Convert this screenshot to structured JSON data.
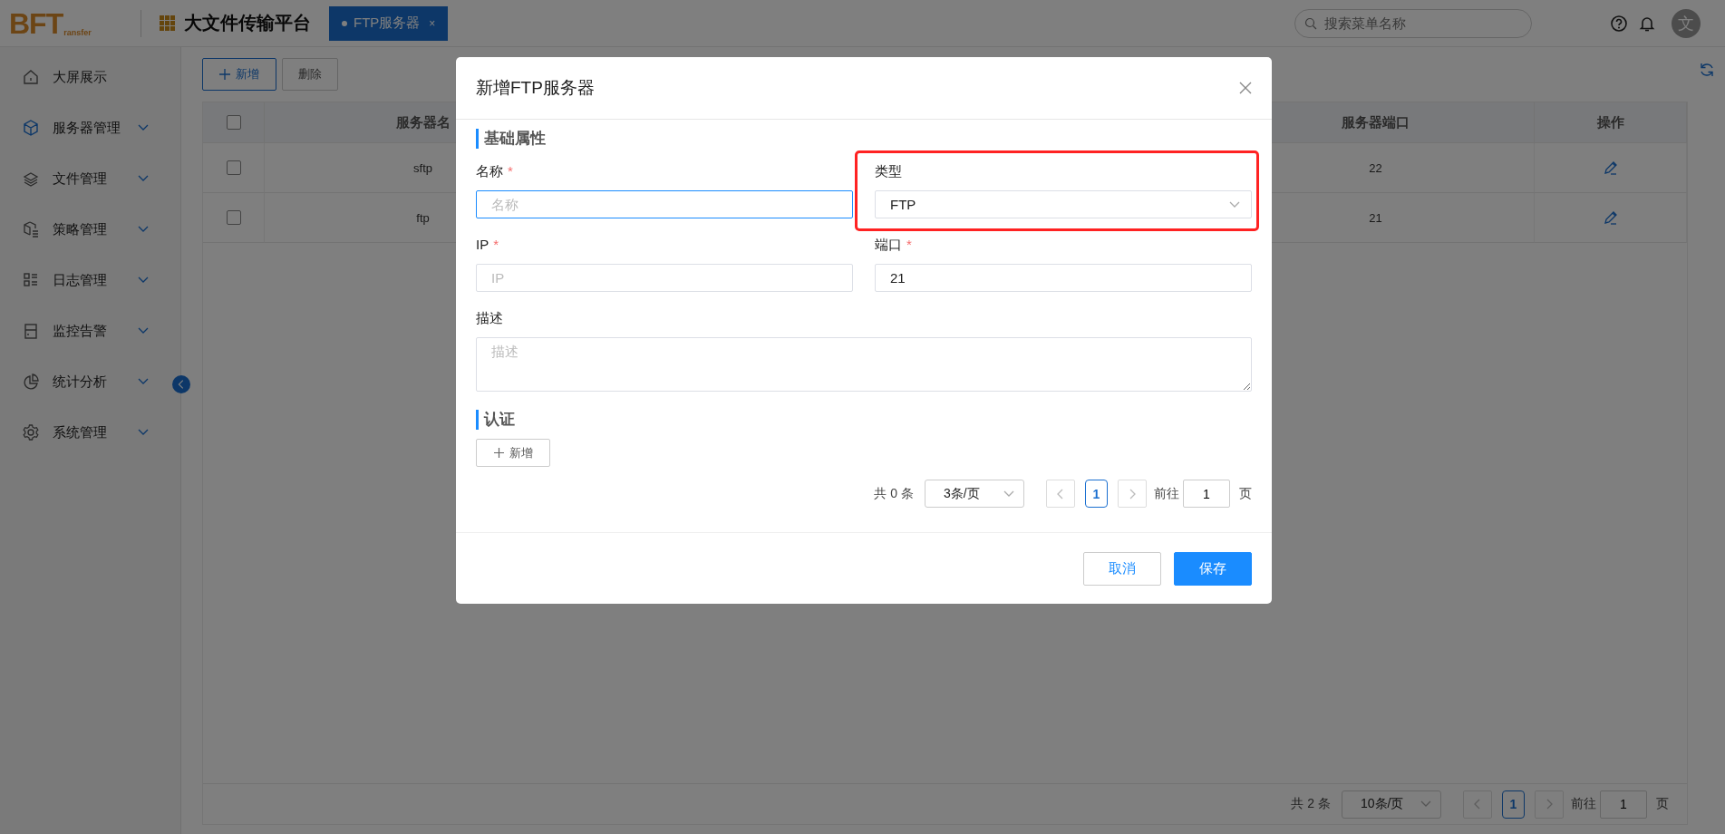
{
  "header": {
    "logo": {
      "text": "BFT",
      "subtext": "ransfer"
    },
    "app_title": "大文件传输平台",
    "tabs": [
      {
        "label": "FTP服务器",
        "selected": true,
        "close": "×"
      }
    ],
    "search": {
      "placeholder": "搜索菜单名称"
    },
    "avatar": "文"
  },
  "sidebar": {
    "items": [
      {
        "label": "大屏展示",
        "selected": false,
        "expandable": false
      },
      {
        "label": "服务器管理",
        "selected": true,
        "expandable": true
      },
      {
        "label": "文件管理",
        "selected": false,
        "expandable": true
      },
      {
        "label": "策略管理",
        "selected": false,
        "expandable": true
      },
      {
        "label": "日志管理",
        "selected": false,
        "expandable": true
      },
      {
        "label": "监控告警",
        "selected": false,
        "expandable": true
      },
      {
        "label": "统计分析",
        "selected": false,
        "expandable": true
      },
      {
        "label": "系统管理",
        "selected": false,
        "expandable": true
      }
    ]
  },
  "toolbar": {
    "buttons": [
      {
        "label": "新增",
        "kind": "primary"
      },
      {
        "label": "删除",
        "kind": "default"
      }
    ]
  },
  "table": {
    "columns": [
      {
        "kind": "checkbox",
        "checked": false
      },
      {
        "kind": "text",
        "label": "服务器名"
      },
      {
        "kind": "text",
        "label": "服务器端口"
      },
      {
        "kind": "actions",
        "label": "操作"
      }
    ],
    "rows": [
      {
        "cells": [
          {
            "checked": false
          },
          "sftp",
          "22",
          {
            "kind": "edit"
          }
        ]
      },
      {
        "cells": [
          {
            "checked": false
          },
          "ftp",
          "21",
          {
            "kind": "edit"
          }
        ]
      }
    ]
  },
  "pagination": {
    "total": "共 2 条",
    "page_size": "10条/页",
    "pages": [
      {
        "label": "1",
        "selected": true
      }
    ],
    "goto_label": "前往",
    "goto_value": "1",
    "page_suffix": "页"
  },
  "dialog": {
    "title": "新增FTP服务器",
    "sections": [
      {
        "title": "基础属性",
        "fields": [
          {
            "kind": "input",
            "label": "名称",
            "required_mark": "*",
            "placeholder": "名称",
            "focused": true,
            "highlighted": false
          },
          {
            "kind": "select",
            "label": "类型",
            "value": "FTP",
            "focused": false,
            "highlighted": true
          },
          {
            "kind": "input",
            "label": "IP",
            "required_mark": "*",
            "placeholder": "IP",
            "focused": false,
            "highlighted": false
          },
          {
            "kind": "input",
            "label": "端口",
            "required_mark": "*",
            "value": "21",
            "focused": false,
            "highlighted": false
          },
          {
            "kind": "textarea",
            "label": "描述",
            "placeholder": "描述",
            "focused": false,
            "highlighted": false
          }
        ]
      },
      {
        "title": "认证",
        "add_button": "新增",
        "pagination": {
          "total": "共 0 条",
          "page_size": "3条/页",
          "pages": [
            {
              "label": "1",
              "selected": true
            }
          ],
          "goto_label": "前往",
          "goto_value": "1",
          "page_suffix": "页"
        }
      }
    ],
    "buttons": [
      {
        "label": "取消",
        "kind": "default"
      },
      {
        "label": "保存",
        "kind": "primary"
      }
    ]
  }
}
